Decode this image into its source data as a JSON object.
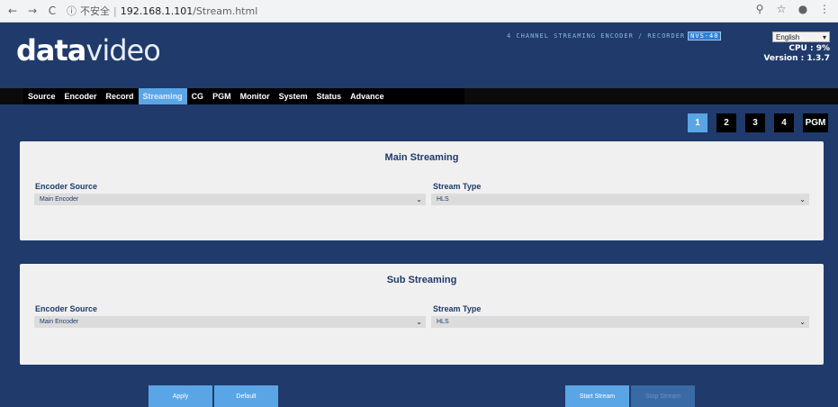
{
  "browser": {
    "back": "←",
    "forward": "→",
    "reload": "C",
    "security": "不安全",
    "separator": "|",
    "host": "192.168.1.101",
    "path": "/Stream.html",
    "icons": [
      "zoom-icon",
      "star-icon",
      "profile-icon",
      "menu-icon"
    ]
  },
  "header": {
    "logo_bold": "data",
    "logo_thin": "video",
    "product": "4 CHANNEL STREAMING ENCODER / RECORDER",
    "model": "NVS-40",
    "language": "English",
    "cpu": "CPU : 9%",
    "version": "Version : 1.3.7"
  },
  "menu": [
    "Source",
    "Encoder",
    "Record",
    "Streaming",
    "CG",
    "PGM",
    "Monitor",
    "System",
    "Status",
    "Advance"
  ],
  "active_menu": "Streaming",
  "pager": [
    "1",
    "2",
    "3",
    "4",
    "PGM"
  ],
  "pager_selected": "1",
  "main": {
    "title": "Main Streaming",
    "encoder_source_label": "Encoder Source",
    "encoder_source_value": "Main Encoder",
    "stream_type_label": "Stream Type",
    "stream_type_value": "HLS"
  },
  "sub": {
    "title": "Sub Streaming",
    "encoder_source_label": "Encoder Source",
    "encoder_source_value": "Main Encoder",
    "stream_type_label": "Stream Type",
    "stream_type_value": "HLS"
  },
  "buttons": {
    "apply": "Apply",
    "default": "Default",
    "start": "Start Stream",
    "stop": "Stop Stream"
  },
  "colors": {
    "background": "#1f3a6b",
    "accent": "#5aa5e6",
    "menu_bg": "#000000"
  }
}
